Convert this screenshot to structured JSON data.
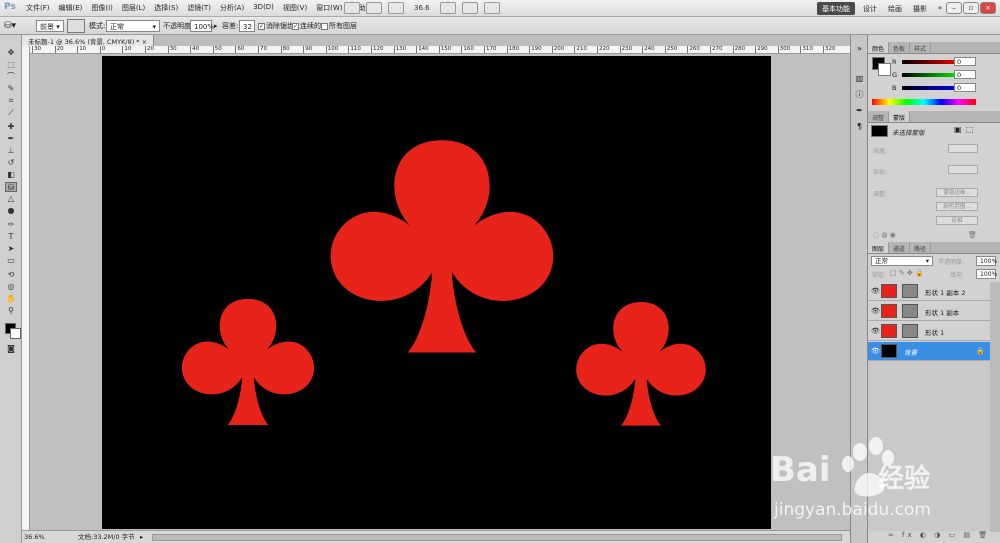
{
  "app": {
    "logo": "Ps",
    "menus": [
      "文件(F)",
      "编辑(E)",
      "图像(I)",
      "图层(L)",
      "选择(S)",
      "滤镜(T)",
      "分析(A)",
      "3D(D)",
      "视图(V)",
      "窗口(W)",
      "帮助(H)"
    ],
    "zoom": "36.6",
    "workspaces": [
      "基本功能",
      "设计",
      "绘画",
      "摄影"
    ]
  },
  "options": {
    "fill_source": "前景",
    "mode_label": "模式:",
    "mode_value": "正常",
    "opacity_label": "不透明度:",
    "opacity_value": "100%",
    "tolerance_label": "容差:",
    "tolerance_value": "32",
    "antialias_label": "消除锯齿",
    "contiguous_label": "连续的",
    "all_layers_label": "所有图层"
  },
  "document": {
    "tab_title": "未标题-1 @ 36.6% (背景, CMYK/8) *",
    "ruler_ticks": [
      "30",
      "20",
      "10",
      "0",
      "10",
      "20",
      "30",
      "40",
      "50",
      "60",
      "70",
      "80",
      "90",
      "100",
      "110",
      "120",
      "130",
      "140",
      "150",
      "160",
      "170",
      "180",
      "190",
      "200",
      "210",
      "220",
      "230",
      "240",
      "250",
      "260",
      "270",
      "280",
      "290",
      "300",
      "310",
      "320"
    ],
    "canvas_color": "#000000",
    "shape_color": "#e8231a"
  },
  "status": {
    "zoom": "36.6%",
    "doc_size": "文档:33.2M/0 字节"
  },
  "panels": {
    "color_tabs": [
      "颜色",
      "色板",
      "样式"
    ],
    "rgb": [
      {
        "label": "R",
        "value": "0"
      },
      {
        "label": "G",
        "value": "0"
      },
      {
        "label": "B",
        "value": "0"
      }
    ],
    "adjust_tabs": [
      "调整",
      "蒙版"
    ],
    "mask_title": "未选择蒙版",
    "mask_rows": [
      "浓度:",
      "羽化:",
      "调整:"
    ],
    "mask_buttons": [
      "蒙版边缘...",
      "颜色范围...",
      "反相"
    ],
    "layer_tabs": [
      "图层",
      "通道",
      "路径"
    ],
    "blend_mode": "正常",
    "opacity_label": "不透明度:",
    "opacity_value": "100%",
    "lock_label": "锁定:",
    "fill_label": "填充:",
    "fill_value": "100%",
    "layers": [
      {
        "name": "形状 1 副本 2",
        "thumb": "#e8231a"
      },
      {
        "name": "形状 1 副本",
        "thumb": "#e8231a"
      },
      {
        "name": "形状 1",
        "thumb": "#e8231a"
      },
      {
        "name": "背景",
        "thumb": "#000000"
      }
    ]
  },
  "watermark": {
    "brand": "Bai",
    "brand_suffix": "经验",
    "url": "jingyan.baidu.com"
  }
}
